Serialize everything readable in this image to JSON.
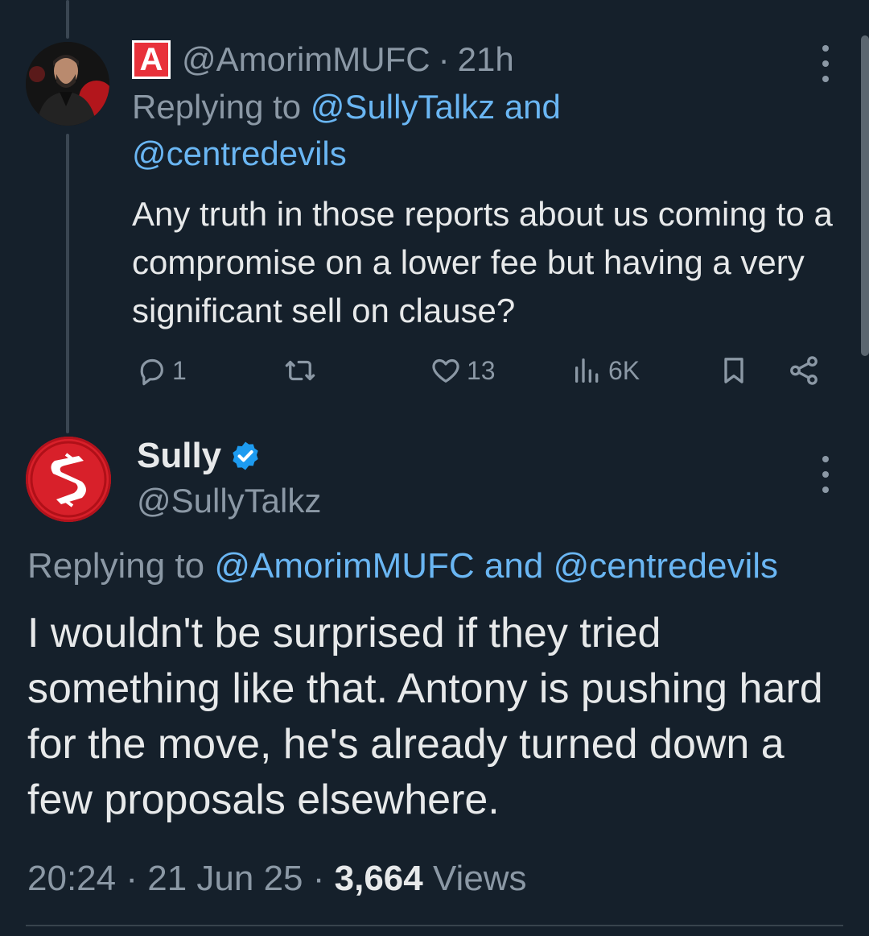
{
  "tweet1": {
    "badge": "A",
    "handle": "@AmorimMUFC",
    "separator": "·",
    "time": "21h",
    "replying_prefix": "Replying to",
    "reply_mention1": "@SullyTalkz",
    "reply_and": "and",
    "reply_mention2": "@centredevils",
    "text": "Any truth in those reports about us coming to a compromise on a lower fee but having a very significant sell on clause?",
    "actions": {
      "reply_count": "1",
      "retweet_count": "",
      "like_count": "13",
      "views_count": "6K"
    }
  },
  "tweet2": {
    "display_name": "Sully",
    "handle": "@SullyTalkz",
    "replying_prefix": "Replying to",
    "reply_mention1": "@AmorimMUFC",
    "reply_and": "and",
    "reply_mention2": "@centredevils",
    "text": "I wouldn't be surprised if they tried something like that. Antony is pushing hard for the move, he's already turned down a few proposals elsewhere.",
    "time": "20:24",
    "separator": "·",
    "date": "21 Jun 25",
    "views_count": "3,664",
    "views_label": "Views"
  },
  "colors": {
    "background": "#15202b",
    "link": "#6ab6f3",
    "muted": "#8b98a5",
    "text": "#e7e9ea",
    "verified": "#1d9bf0",
    "badge": "#e8313a"
  },
  "icons": [
    "more-icon",
    "reply-icon",
    "retweet-icon",
    "like-icon",
    "views-icon",
    "bookmark-icon",
    "share-icon",
    "verified-icon"
  ]
}
